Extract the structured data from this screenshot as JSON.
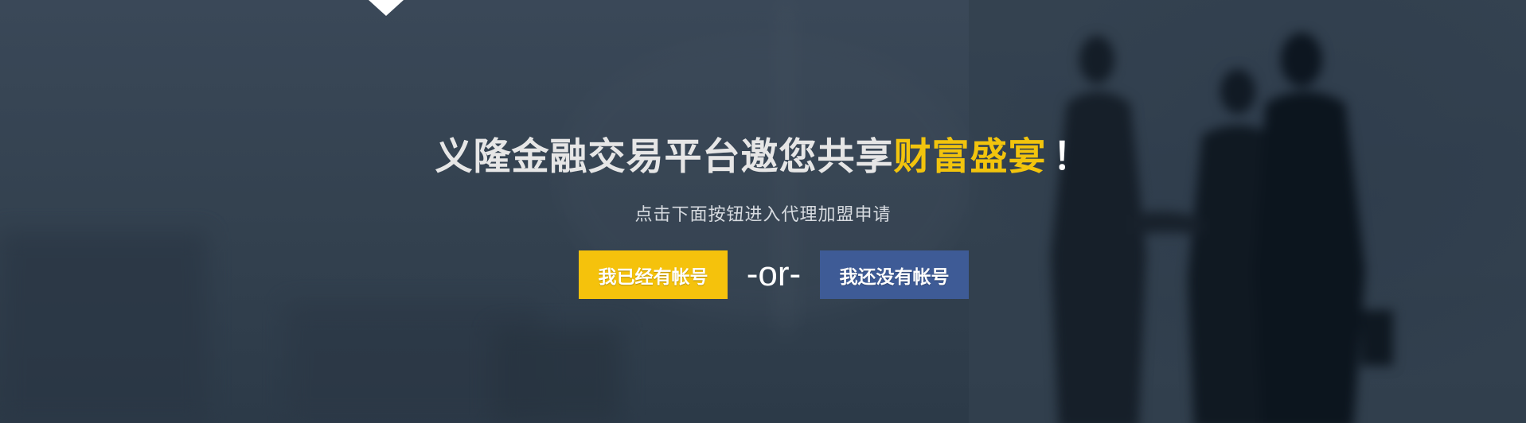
{
  "banner": {
    "headline_main": "义隆金融交易平台邀您共享",
    "headline_accent": "财富盛宴",
    "headline_exclaim": "！",
    "subtitle": "点击下面按钮进入代理加盟申请",
    "login_button": "我已经有帐号",
    "separator": "-or-",
    "register_button": "我还没有帐号"
  },
  "colors": {
    "accent": "#f2c40d",
    "login_bg": "#f5c20c",
    "register_bg": "#3e5b96",
    "background": "#33414f"
  }
}
